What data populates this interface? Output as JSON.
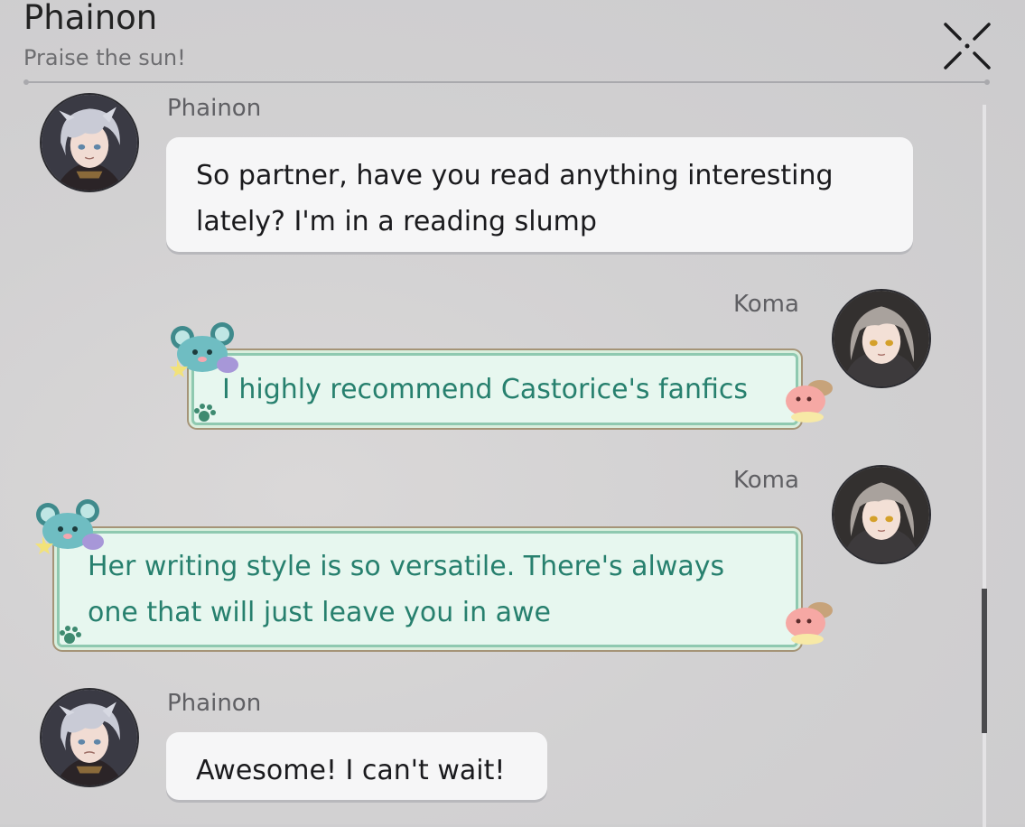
{
  "header": {
    "title": "Phainon",
    "subtitle": "Praise the sun!",
    "close_icon": "close-x-icon"
  },
  "colors": {
    "background": "#d1d0d1",
    "bubble_plain": "#f6f6f7",
    "bubble_sticker": "#e7f7ef",
    "sticker_text": "#27806e",
    "sender_text": "#5f5f63"
  },
  "messages": [
    {
      "sender": "Phainon",
      "text": "So partner, have you read anything interesting lately? I'm in a reading slump",
      "side": "left"
    },
    {
      "sender": "Koma",
      "text": "I highly recommend Castorice's fanfics",
      "side": "right"
    },
    {
      "sender": "Koma",
      "text": "Her writing style is so versatile. There's always one that will just leave you in awe",
      "side": "right"
    },
    {
      "sender": "Phainon",
      "text": "Awesome! I can't wait!",
      "side": "left"
    }
  ]
}
